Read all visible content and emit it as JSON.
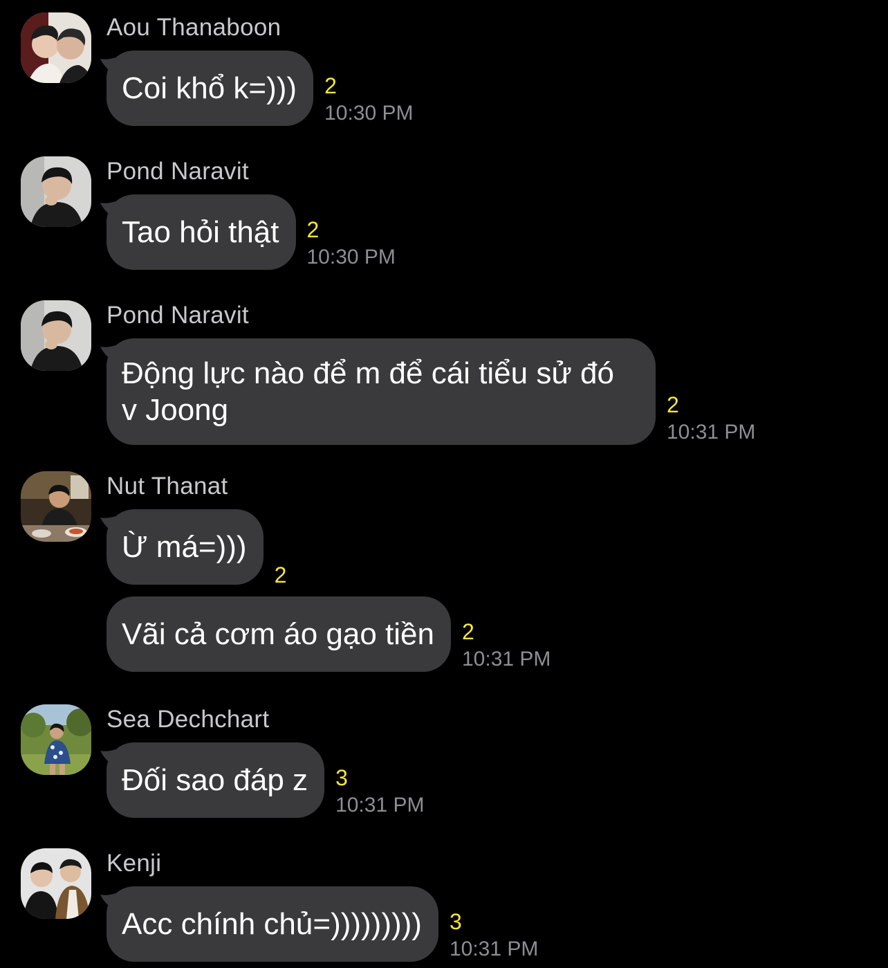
{
  "theme": {
    "background": "#000000",
    "bubble_color": "#3a3a3c",
    "read_color": "#f5e63d",
    "time_color": "#8e8e93",
    "sender_color": "#c9c9cd"
  },
  "messages": [
    {
      "sender": "Aou Thanaboon",
      "avatar_icon": "user-avatar-icon",
      "bubbles": [
        {
          "text": "Coi khổ k=)))",
          "read": "2",
          "time": "10:30 PM"
        }
      ]
    },
    {
      "sender": "Pond Naravit",
      "avatar_icon": "user-avatar-icon",
      "bubbles": [
        {
          "text": "Tao hỏi thật",
          "read": "2",
          "time": "10:30 PM"
        }
      ]
    },
    {
      "sender": "Pond Naravit",
      "avatar_icon": "user-avatar-icon",
      "bubbles": [
        {
          "line1": "Động lực nào để m để cái tiểu sử đó",
          "line2": "v Joong",
          "read": "2",
          "time": "10:31 PM"
        }
      ]
    },
    {
      "sender": "Nut Thanat",
      "avatar_icon": "user-avatar-icon",
      "bubbles": [
        {
          "text": "Ừ má=)))",
          "read": "2",
          "time": ""
        },
        {
          "text": "Vãi cả cơm áo gạo tiền",
          "read": "2",
          "time": "10:31 PM"
        }
      ]
    },
    {
      "sender": "Sea Dechchart",
      "avatar_icon": "user-avatar-icon",
      "bubbles": [
        {
          "text": "Đối sao đáp z",
          "read": "3",
          "time": "10:31 PM"
        }
      ]
    },
    {
      "sender": "Kenji",
      "avatar_icon": "user-avatar-icon",
      "bubbles": [
        {
          "text": "Acc chính chủ=)))))))))",
          "read": "3",
          "time": "10:31 PM"
        }
      ]
    }
  ]
}
